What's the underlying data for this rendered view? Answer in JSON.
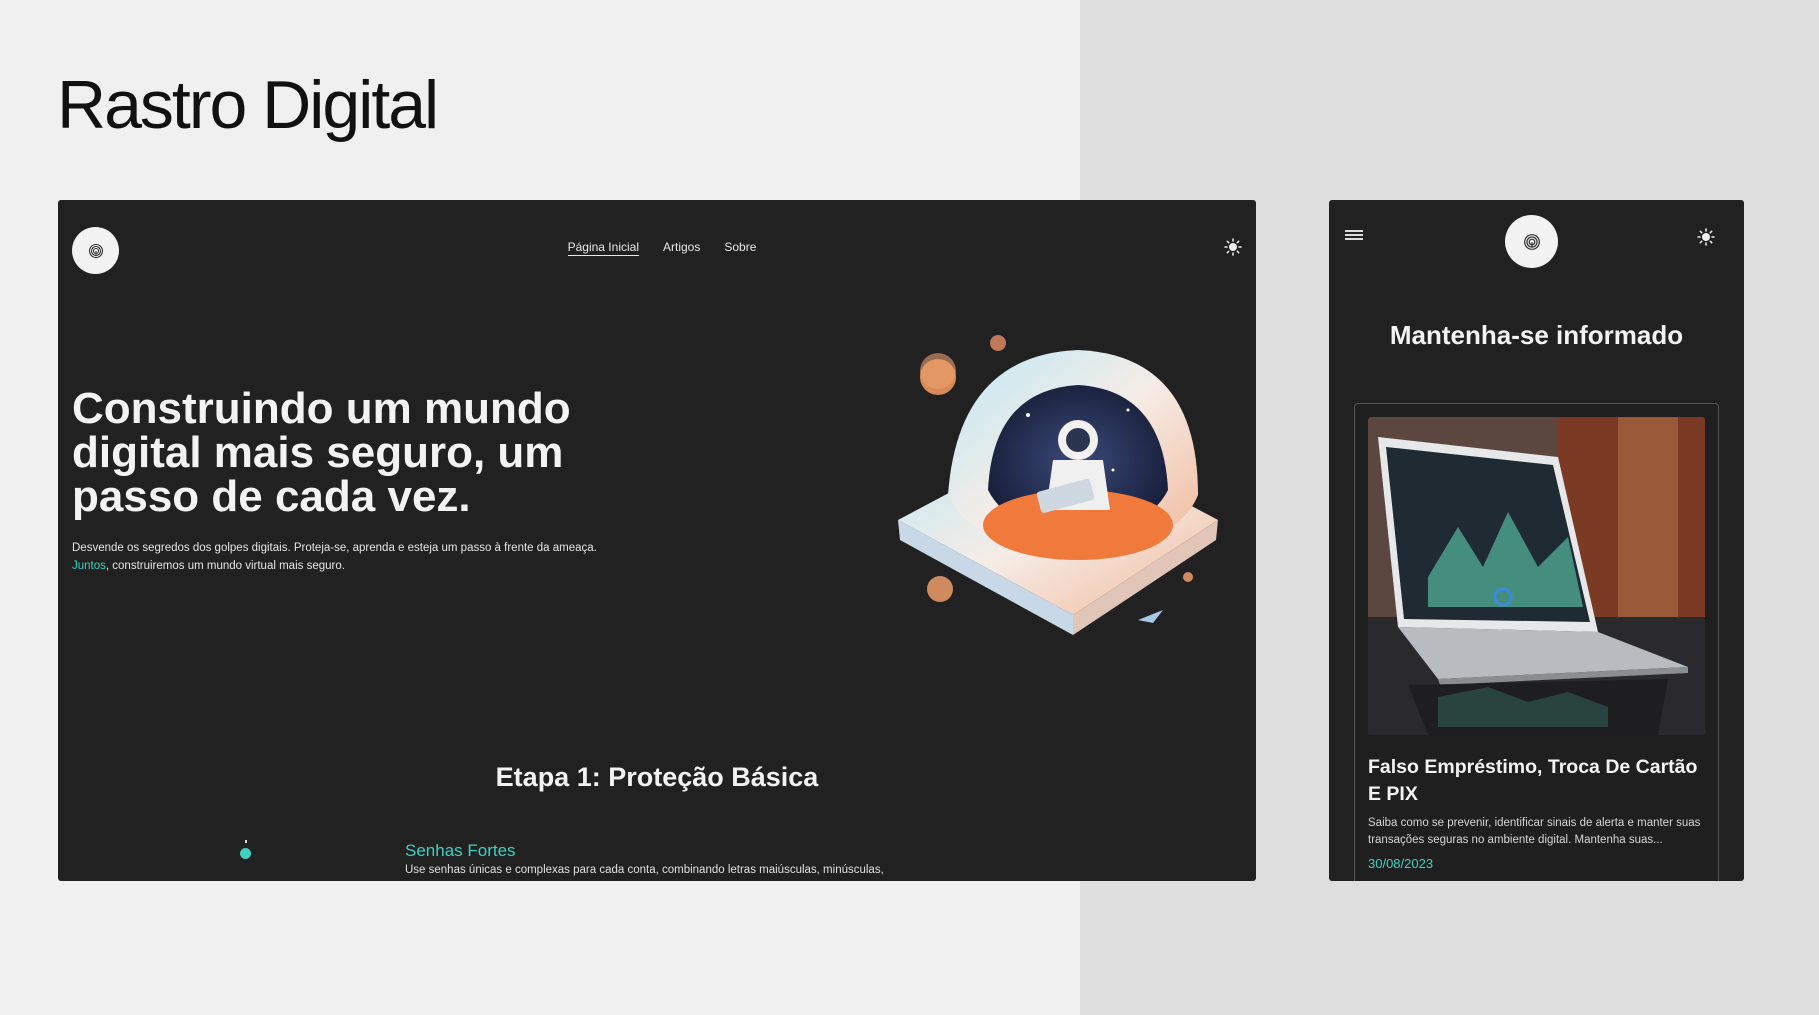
{
  "page": {
    "title": "Rastro Digital"
  },
  "desktop": {
    "nav": {
      "items": [
        "Página Inicial",
        "Artigos",
        "Sobre"
      ],
      "active": "Página Inicial"
    },
    "hero": {
      "title": "Construindo um mundo digital mais seguro, um passo de cada vez.",
      "subtitle_part1": "Desvende os segredos dos golpes digitais. Proteja-se, aprenda e esteja um passo à frente da ameaça.",
      "subtitle_accent": "Juntos",
      "subtitle_part2": ", construiremos um mundo virtual mais seguro."
    },
    "stage": {
      "title": "Etapa 1: Proteção Básica",
      "step_title": "Senhas Fortes",
      "step_desc": "Use senhas únicas e complexas para cada conta, combinando letras maiúsculas, minúsculas,"
    }
  },
  "mobile": {
    "heading": "Mantenha-se informado",
    "card": {
      "title": "Falso Empréstimo, Troca De Cartão E PIX",
      "desc": "Saiba como se prevenir, identificar sinais de alerta e manter suas transações seguras no ambiente digital. Mantenha suas...",
      "date": "30/08/2023"
    }
  },
  "icons": {
    "logo": "fingerprint-icon",
    "theme_toggle": "sun-icon",
    "menu": "hamburger-icon"
  },
  "colors": {
    "accent": "#3ed1c0",
    "frame_bg": "#212121",
    "page_bg": "#f0f0f0"
  }
}
